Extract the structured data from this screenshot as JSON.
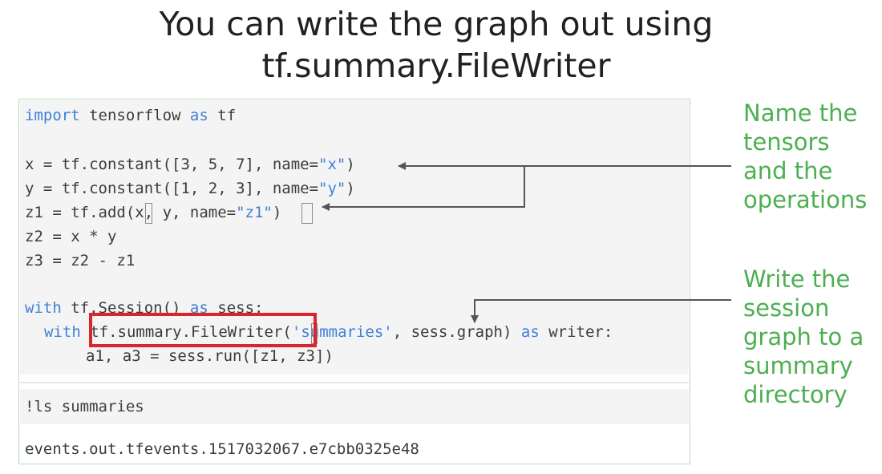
{
  "title": {
    "line1": "You can write the graph out using",
    "line2": "tf.summary.FileWriter"
  },
  "code": {
    "l1_kw1": "import",
    "l1_mid": " tensorflow ",
    "l1_kw2": "as",
    "l1_end": " tf",
    "l2_pre": "x = tf.constant([3, 5, 7], name=",
    "l2_str": "\"x\"",
    "l2_end": ")",
    "l3_pre": "y = tf.constant([1, 2, 3], name=",
    "l3_str": "\"y\"",
    "l3_end": ")",
    "l4_pre": "z1 = tf.add(x, y, name=",
    "l4_str": "\"z1\"",
    "l4_end": ")",
    "l5": "z2 = x * y",
    "l6": "z3 = z2 - z1",
    "l7_kw1": "with",
    "l7_mid": " tf.Session() ",
    "l7_kw2": "as",
    "l7_end": " sess:",
    "l8_kw1": "with",
    "l8_mid": " tf.summary.FileWriter(",
    "l8_str": "'summaries'",
    "l8_mid2": ", sess.graph) ",
    "l8_kw2": "as",
    "l8_end": " writer:",
    "l9": "a1, a3 = sess.run([z1, z3])"
  },
  "ls_command": "!ls summaries",
  "ls_output": "events.out.tfevents.1517032067.e7cbb0325e48",
  "annotations": {
    "name_tensors": "Name the\ntensors\nand the\noperations",
    "write_graph": "Write the\nsession\ngraph to a\nsummary\ndirectory"
  },
  "colors": {
    "keyword": "#3f7fd6",
    "annotation": "#4caf50",
    "highlight": "#d9252b"
  }
}
